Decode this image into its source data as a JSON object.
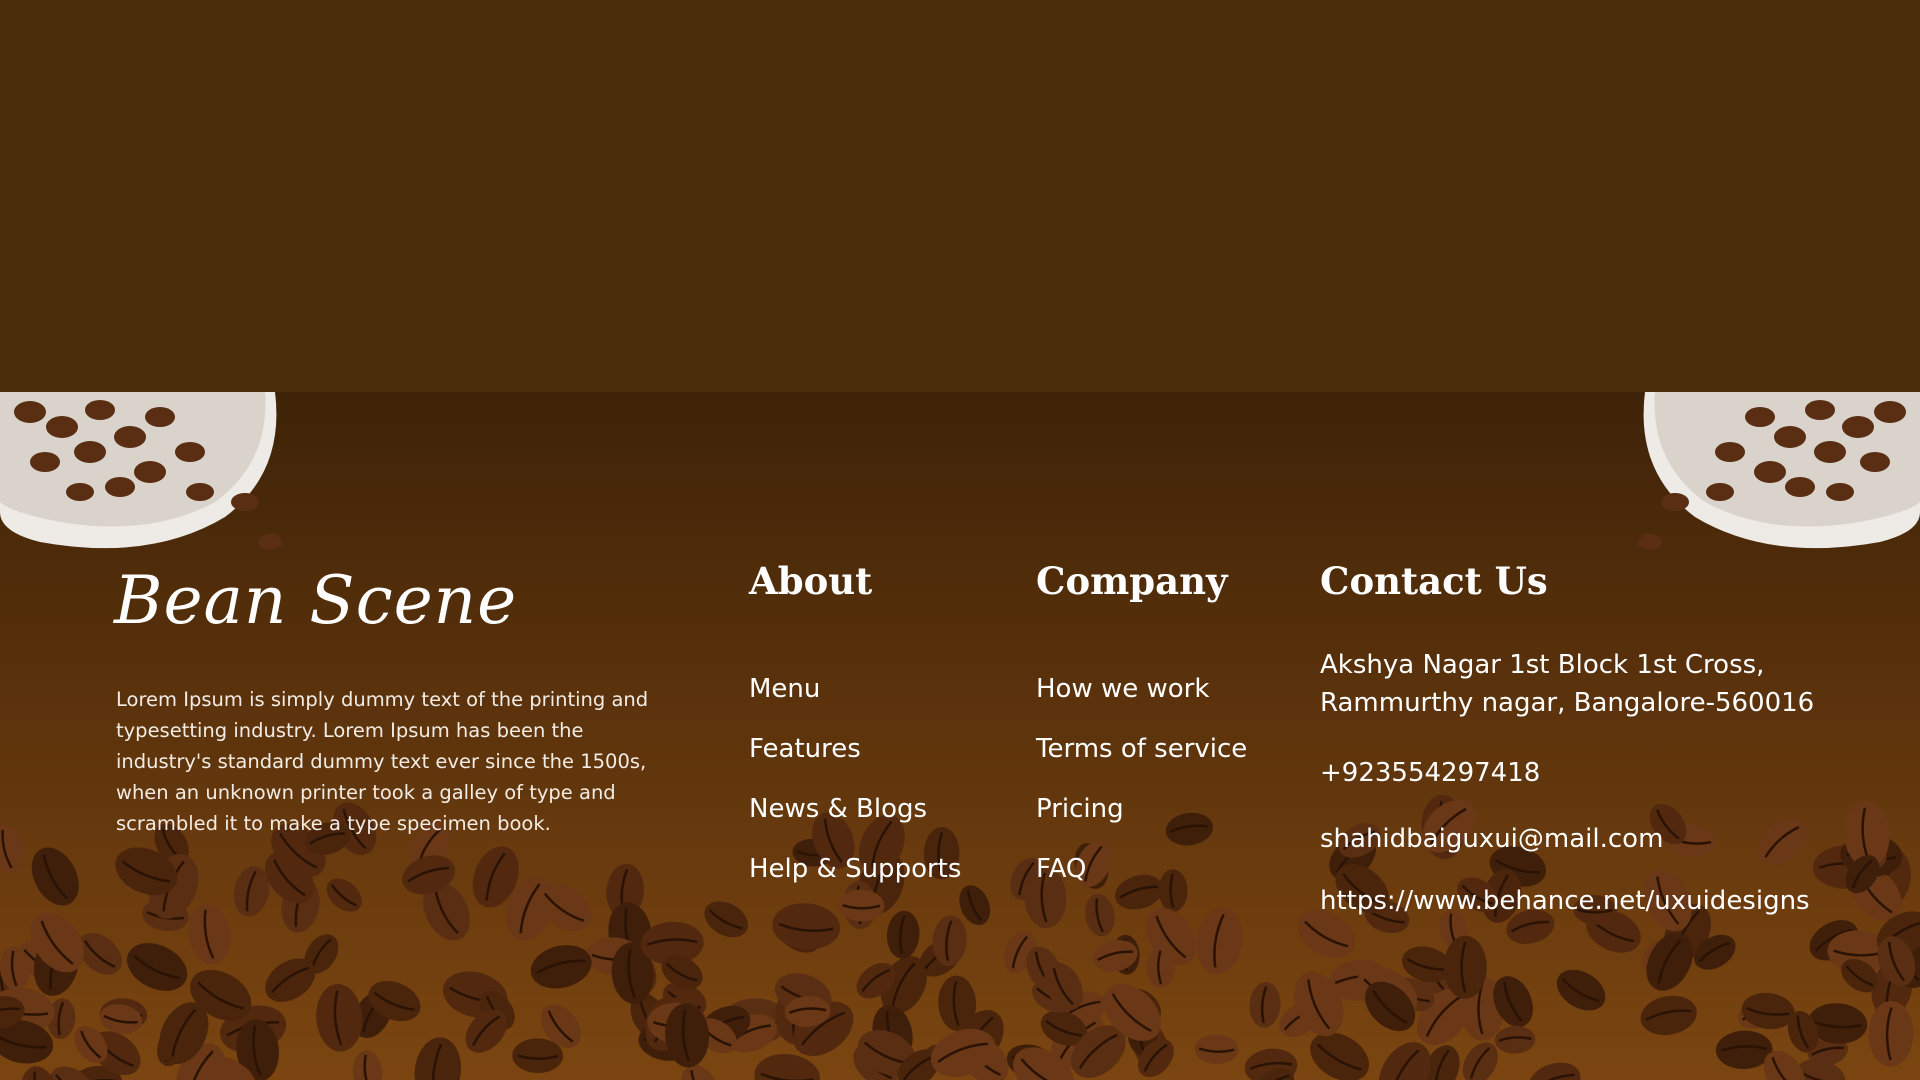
{
  "brand": {
    "name": "Bean Scene"
  },
  "about_text": "Lorem Ipsum is simply dummy text of the printing and typesetting industry. Lorem Ipsum has been the industry's standard dummy text ever since the 1500s, when an unknown printer took a galley of type and scrambled it to make a type specimen book.",
  "columns": {
    "about": {
      "title": "About",
      "links": [
        "Menu",
        "Features",
        "News & Blogs",
        "Help & Supports"
      ]
    },
    "company": {
      "title": "Company",
      "links": [
        "How we work",
        "Terms of service",
        "Pricing",
        "FAQ"
      ]
    },
    "contact": {
      "title": "Contact Us",
      "address_line1": "Akshya Nagar 1st Block 1st Cross,",
      "address_line2": "Rammurthy nagar, Bangalore-560016",
      "phone": "+923554297418",
      "email": "shahidbaiguxui@mail.com",
      "website": "https://www.behance.net/uxuidesigns"
    }
  },
  "colors": {
    "top_band": "#4a2c0a",
    "footer_top": "#3e2308",
    "footer_bottom": "#7a4510",
    "text": "#ffffff",
    "bean": "#4a250c"
  }
}
